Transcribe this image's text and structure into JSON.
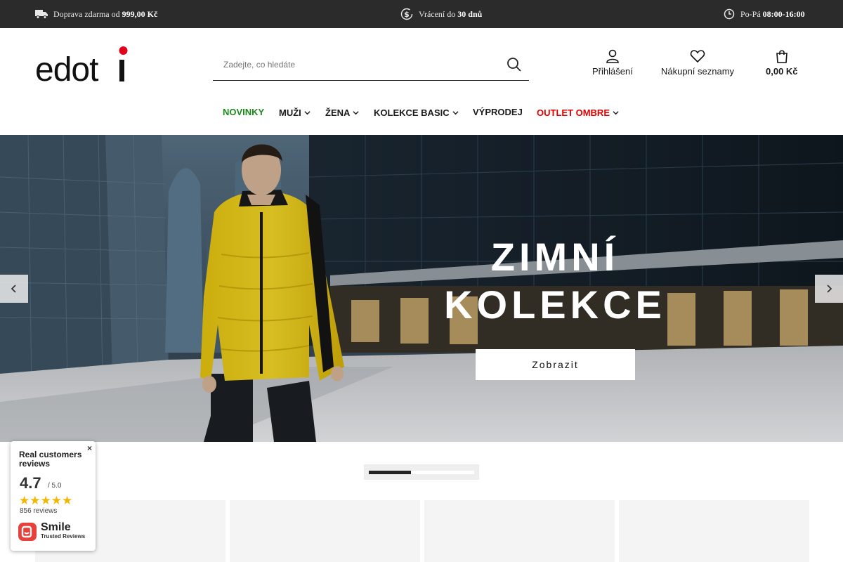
{
  "topbar": {
    "shipping_prefix": "Doprava zdarma od",
    "shipping_amount": "999,00 Kč",
    "returns_prefix": "Vrácení do",
    "returns_days": "30 dnů",
    "hours_prefix": "Po-Pá",
    "hours_value": "08:00-16:00",
    "icons": [
      "truck-icon",
      "money-return-icon",
      "clock-icon"
    ]
  },
  "header": {
    "logo_text": "edoti",
    "logo_dot_color": "#e2001a",
    "search_placeholder": "Zadejte, co hledáte",
    "login_label": "Přihlášení",
    "wishlist_label": "Nákupní seznamy",
    "cart_total": "0,00 Kč"
  },
  "nav": {
    "items": [
      {
        "label": "NOVINKY",
        "color": "#1a8a1a",
        "dropdown": false
      },
      {
        "label": "MUŽI",
        "color": "#1a1a1a",
        "dropdown": true
      },
      {
        "label": "ŽENA",
        "color": "#1a1a1a",
        "dropdown": true
      },
      {
        "label": "KOLEKCE BASIC",
        "color": "#1a1a1a",
        "dropdown": true
      },
      {
        "label": "VÝPRODEJ",
        "color": "#1a1a1a",
        "dropdown": false
      },
      {
        "label": "OUTLET OMBRE",
        "color": "#e00000",
        "dropdown": true
      }
    ]
  },
  "hero": {
    "headline_line1": "ZIMNÍ",
    "headline_line2": "KOLEKCE",
    "cta_label": "Zobrazit",
    "slide_progress": 0.4
  },
  "reviews_widget": {
    "title": "Real customers reviews",
    "score": "4.7",
    "out_of": "/ 5.0",
    "stars": "★★★★★",
    "count": "856 reviews",
    "brand": "Smile",
    "brand_sub": "Trusted Reviews",
    "close": "×"
  }
}
